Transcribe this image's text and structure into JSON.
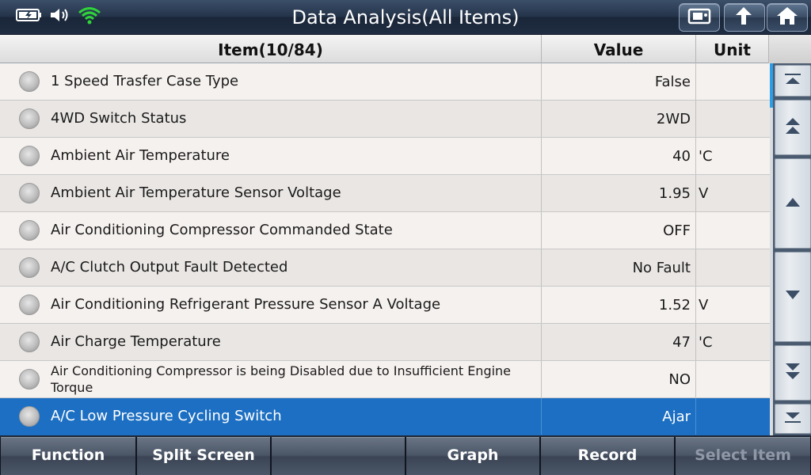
{
  "window": {
    "title": "Data Analysis(All Items)"
  },
  "status_icons": [
    "battery-icon",
    "volume-icon",
    "wifi-icon"
  ],
  "toolbar_icons": [
    "screenshot-icon",
    "back-icon",
    "home-icon"
  ],
  "table": {
    "headers": {
      "item": "Item(10/84)",
      "value": "Value",
      "unit": "Unit"
    },
    "rows": [
      {
        "item": "1 Speed Trasfer Case Type",
        "value": "False",
        "unit": ""
      },
      {
        "item": "4WD Switch Status",
        "value": "2WD",
        "unit": ""
      },
      {
        "item": "Ambient Air Temperature",
        "value": "40",
        "unit": "'C"
      },
      {
        "item": "Ambient Air Temperature Sensor Voltage",
        "value": "1.95",
        "unit": "V"
      },
      {
        "item": "Air Conditioning Compressor Commanded State",
        "value": "OFF",
        "unit": ""
      },
      {
        "item": "A/C Clutch Output Fault Detected",
        "value": "No Fault",
        "unit": ""
      },
      {
        "item": "Air Conditioning Refrigerant Pressure Sensor A Voltage",
        "value": "1.52",
        "unit": "V"
      },
      {
        "item": "Air Charge Temperature",
        "value": "47",
        "unit": "'C"
      },
      {
        "item": "Air Conditioning Compressor is being Disabled due to Insufficient Engine Torque",
        "value": "NO",
        "unit": ""
      },
      {
        "item": "A/C Low Pressure Cycling Switch",
        "value": "Ajar",
        "unit": ""
      }
    ],
    "selected_index": 9
  },
  "scroll_buttons": [
    "scroll-top-icon",
    "page-up-icon",
    "line-up-icon",
    "line-down-icon",
    "page-down-icon",
    "scroll-bottom-icon"
  ],
  "bottom_bar": {
    "function": "Function",
    "split_screen": "Split Screen",
    "empty": "",
    "graph": "Graph",
    "record": "Record",
    "select_item": "Select Item"
  },
  "colors": {
    "selected_row": "#1c6fc2",
    "scroll_thumb": "#2a9ee8",
    "wifi": "#2fd33a"
  }
}
